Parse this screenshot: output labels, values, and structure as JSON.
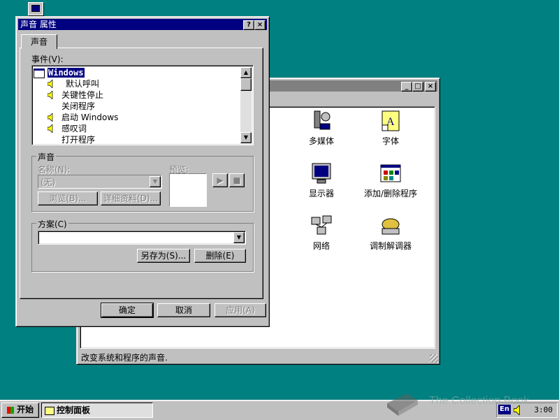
{
  "desktop": {
    "bg": "#008080"
  },
  "control_panel": {
    "status": "改变系统和程序的声音.",
    "items": [
      {
        "label": "多媒体",
        "icon": "multimedia-icon"
      },
      {
        "label": "字体",
        "icon": "fonts-icon"
      },
      {
        "label": "显示器",
        "icon": "display-icon"
      },
      {
        "label": "添加/删除程序",
        "icon": "add-remove-programs-icon"
      },
      {
        "label": "网络",
        "icon": "network-icon"
      },
      {
        "label": "调制解调器",
        "icon": "modem-icon"
      }
    ]
  },
  "dialog": {
    "title": "声音 属性",
    "tab": "声音",
    "events_label": "事件(V):",
    "events": [
      {
        "label": "Windows",
        "selected": true,
        "sound": false
      },
      {
        "label": "默认呼叫",
        "sound": true
      },
      {
        "label": "关键性停止",
        "sound": true
      },
      {
        "label": "关闭程序",
        "sound": false
      },
      {
        "label": "启动 Windows",
        "sound": true
      },
      {
        "label": "感叹词",
        "sound": true
      },
      {
        "label": "打开程序",
        "sound": false
      }
    ],
    "sound_group": "声音",
    "name_label": "名称(N):",
    "name_value": "(无)",
    "preview_label": "预览:",
    "browse": "浏览(B)...",
    "details": "详细资料(D)...",
    "scheme_group": "方案(C)",
    "scheme_value": "",
    "save_as": "另存为(S)...",
    "delete": "删除(E)",
    "ok": "确定",
    "cancel": "取消",
    "apply": "应用(A)"
  },
  "taskbar": {
    "start": "开始",
    "task": "控制面板",
    "lang": "En",
    "clock": "3:00"
  },
  "watermark": "The Collection Book"
}
